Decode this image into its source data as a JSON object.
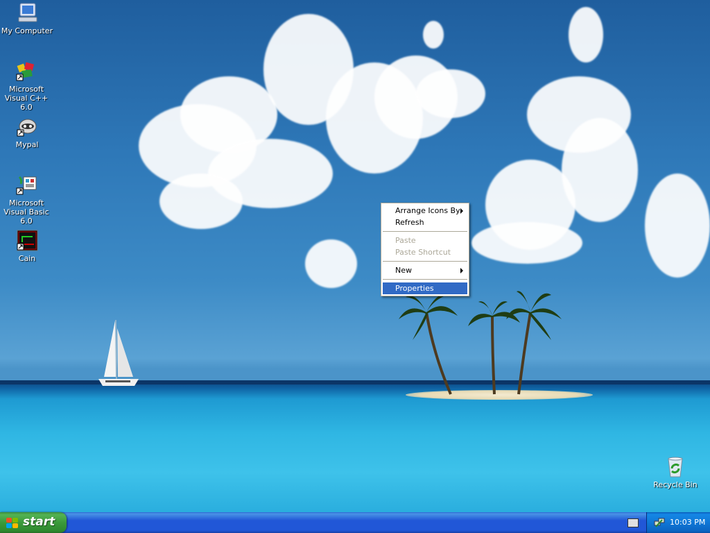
{
  "desktop": {
    "icons": [
      {
        "label": "My Computer"
      },
      {
        "label": "Microsoft Visual C++ 6.0"
      },
      {
        "label": "Mypal"
      },
      {
        "label": "Microsoft Visual Basic 6.0"
      },
      {
        "label": "Cain"
      },
      {
        "label": "Recycle Bin"
      }
    ]
  },
  "context_menu": {
    "items": [
      {
        "label": "Arrange Icons By",
        "submenu": true,
        "enabled": true
      },
      {
        "label": "Refresh",
        "enabled": true
      },
      {
        "label": "Paste",
        "enabled": false
      },
      {
        "label": "Paste Shortcut",
        "enabled": false
      },
      {
        "label": "New",
        "submenu": true,
        "enabled": true
      },
      {
        "label": "Properties",
        "enabled": true,
        "selected": true
      }
    ]
  },
  "taskbar": {
    "start_label": "start",
    "clock": "10:03 PM"
  },
  "colors": {
    "menu_highlight": "#316ac5",
    "taskbar_blue": "#2157d7",
    "start_green": "#3b9a3b",
    "tray_blue": "#0f77d6"
  }
}
